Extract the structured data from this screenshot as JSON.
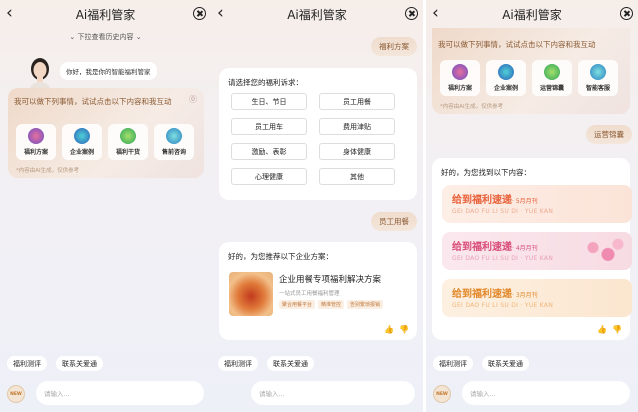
{
  "header": {
    "title": "Ai福利管家"
  },
  "panel1": {
    "history_hint": "⌄ 下拉查看历史内容 ⌄",
    "greeting": "你好，我是你的智能福利管家",
    "welcome_text": "我可以做下列事情，试试点击以下内容和我互动",
    "tiles": [
      "福利方案",
      "企业案例",
      "福利干货",
      "售前咨询"
    ],
    "note": "*内容由AI生成，仅供参考"
  },
  "panel2": {
    "user_msg1": "福利方案",
    "choose_title": "请选择您的福利诉求：",
    "options": [
      "生日、节日",
      "员工用餐",
      "员工用车",
      "费用津贴",
      "激励、表彰",
      "身体健康",
      "心理健康",
      "其他"
    ],
    "user_msg2": "员工用餐",
    "rec_title": "好的，为您推荐以下企业方案：",
    "solution_title": "企业用餐专项福利解决方案",
    "solution_sub": "一站式员工用餐福利管理",
    "tags": [
      "聚合用餐平台",
      "精准管控",
      "告别繁琐报销"
    ]
  },
  "panel3": {
    "welcome_text": "我可以做下列事情，试试点击以下内容和我互动",
    "tiles": [
      "福利方案",
      "企业案例",
      "运营锦囊",
      "智能客服"
    ],
    "note": "*内容由AI生成，仅供参考",
    "user_msg": "运营锦囊",
    "found_title": "好的，为您找到以下内容：",
    "mags": [
      {
        "title": "给到福利速递",
        "month": "· 5月月刊",
        "sub": "GEI DAO FU LI SU DI · YUE KAN"
      },
      {
        "title": "给到福利速递",
        "month": "· 4月月刊",
        "sub": "GEI DAO FU LI SU DI · YUE KAN"
      },
      {
        "title": "给到福利速递",
        "month": "· 3月月刊",
        "sub": "GEI DAO FU LI SU DI · YUE KAN"
      }
    ]
  },
  "bottom": {
    "quick": [
      "福利测评",
      "联系关爱通"
    ],
    "new_icon": "NEW",
    "placeholder": "请输入..."
  },
  "icons": {
    "back": "back-arrow-icon",
    "close": "close-circle-icon",
    "like": "thumbs-up-icon",
    "dislike": "thumbs-down-icon",
    "help": "question-icon"
  },
  "colors": {
    "accent": "#8b5a33",
    "mag1": "#e8603a",
    "mag2": "#d94c78",
    "mag3": "#e2882a"
  }
}
